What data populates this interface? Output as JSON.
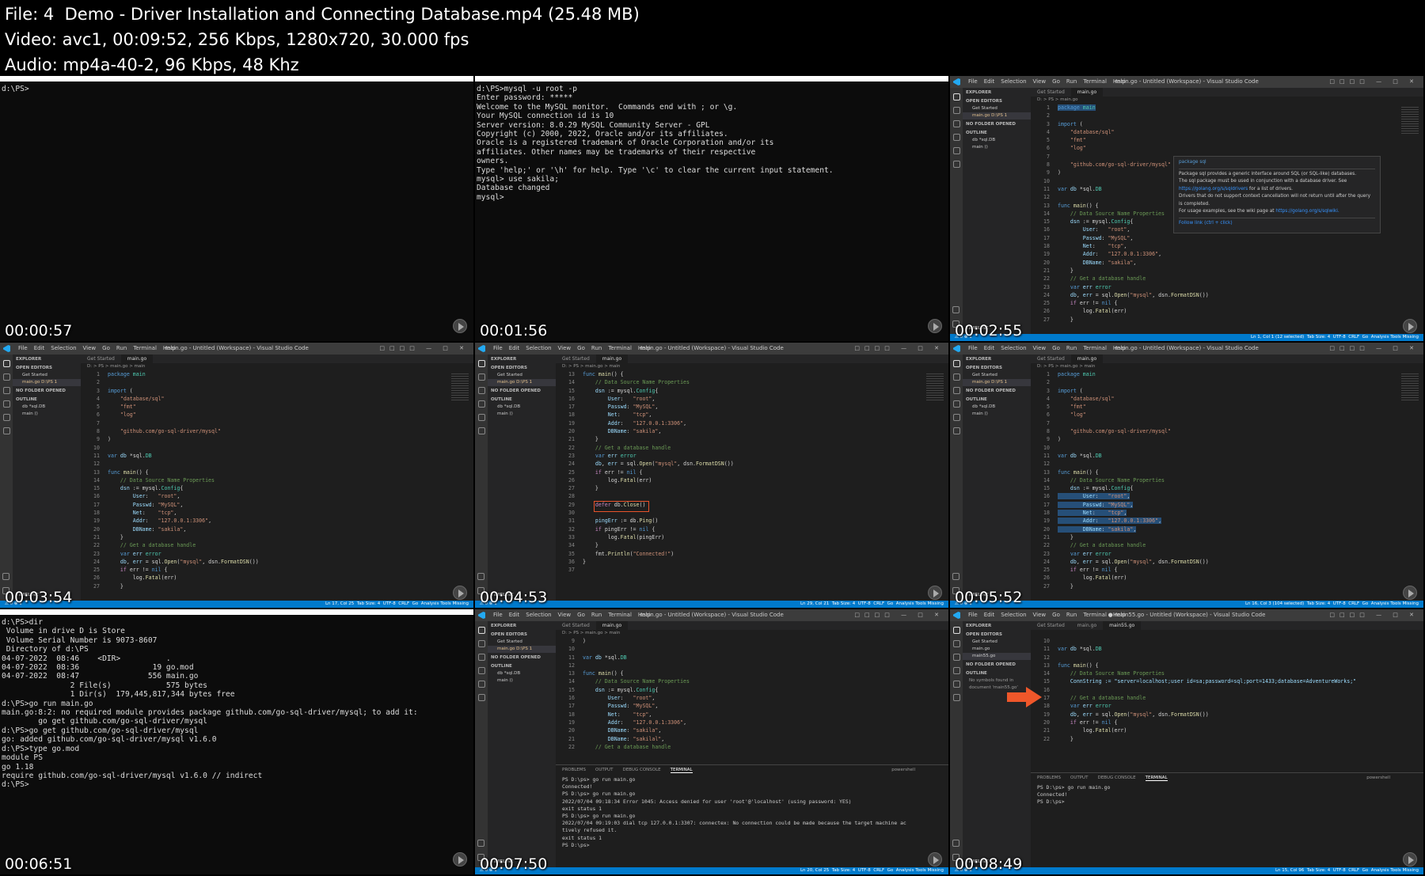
{
  "header": {
    "file": "File: 4  Demo - Driver Installation and Connecting Database.mp4 (25.48 MB)",
    "video": "Video: avc1, 00:09:52, 256 Kbps, 1280x720, 30.000 fps",
    "audio": "Audio: mp4a-40-2, 96 Kbps, 48 Khz"
  },
  "thumbnails": [
    {
      "timestamp": "00:00:57"
    },
    {
      "timestamp": "00:01:56"
    },
    {
      "timestamp": "00:02:55"
    },
    {
      "timestamp": "00:03:54"
    },
    {
      "timestamp": "00:04:53"
    },
    {
      "timestamp": "00:05:52"
    },
    {
      "timestamp": "00:06:51"
    },
    {
      "timestamp": "00:07:50"
    },
    {
      "timestamp": "00:08:49"
    }
  ],
  "terminal1": {
    "lines": [
      "d:\\PS>"
    ]
  },
  "terminal2": {
    "lines": [
      "d:\\PS>mysql -u root -p",
      "Enter password: *****",
      "Welcome to the MySQL monitor.  Commands end with ; or \\g.",
      "Your MySQL connection id is 10",
      "Server version: 8.0.29 MySQL Community Server - GPL",
      "",
      "Copyright (c) 2000, 2022, Oracle and/or its affiliates.",
      "",
      "Oracle is a registered trademark of Oracle Corporation and/or its",
      "affiliates. Other names may be trademarks of their respective",
      "owners.",
      "",
      "Type 'help;' or '\\h' for help. Type '\\c' to clear the current input statement.",
      "",
      "mysql> use sakila;",
      "Database changed",
      "mysql>"
    ]
  },
  "terminal7": {
    "lines": [
      "d:\\PS>dir",
      " Volume in drive D is Store",
      " Volume Serial Number is 9073-8607",
      "",
      " Directory of d:\\PS",
      "",
      "04-07-2022  08:46    <DIR>          .",
      "04-07-2022  08:36                19 go.mod",
      "04-07-2022  08:47               556 main.go",
      "               2 File(s)            575 bytes",
      "               1 Dir(s)  179,445,817,344 bytes free",
      "",
      "d:\\PS>go run main.go",
      "main.go:8:2: no required module provides package github.com/go-sql-driver/mysql; to add it:",
      "        go get github.com/go-sql-driver/mysql",
      "",
      "d:\\PS>go get github.com/go-sql-driver/mysql",
      "go: added github.com/go-sql-driver/mysql v1.6.0",
      "",
      "d:\\PS>type go.mod",
      "module PS",
      "",
      "go 1.18",
      "",
      "require github.com/go-sql-driver/mysql v1.6.0 // indirect",
      "",
      "d:\\PS>"
    ]
  },
  "vscode": {
    "menu": [
      "File",
      "Edit",
      "Selection",
      "View",
      "Go",
      "Run",
      "Terminal",
      "Help"
    ],
    "title": "main.go - Untitled (Workspace) - Visual Studio Code",
    "title_unsaved": "● main55.go - Untitled (Workspace) - Visual Studio Code",
    "explorer_label": "EXPLORER",
    "open_editors": "OPEN EDITORS",
    "no_folder": "NO FOLDER OPENED",
    "outline": "OUTLINE",
    "timeline": "TIMELINE",
    "tab_get_started": "Get Started",
    "tab_main": "main.go",
    "tab_main55": "main55.go",
    "open_file": "main.go D:\\PS 1",
    "outline_db": "db *sql.DB",
    "outline_main": "main ()",
    "crumb": "D: > PS > main.go > main",
    "crumb2": "D: > PS > main.go",
    "no_symbols": "No symbols found in document 'main55.go'",
    "unsaved_badge": "1 UNSAVED",
    "panel_tabs": [
      "PROBLEMS",
      "OUTPUT",
      "DEBUG CONSOLE",
      "TERMINAL"
    ],
    "panel_shell": "powershell",
    "status_lang": "Go",
    "status_analysis": "Analysis Tools Missing",
    "status_enc": "UTF-8",
    "status_eol": "CRLF",
    "status_tab": "Tab Size: 4",
    "status3": "Ln 1, Col 1 (12 selected)",
    "status4": "Ln 17, Col 25",
    "status5": "Ln 29, Col 21",
    "status6": "Ln 16, Col 3 (104 selected)",
    "status8": "Ln 20, Col 25",
    "status9": "Ln 15, Col 96",
    "hover": {
      "title": "package sql",
      "p1": "Package sql provides a generic interface around SQL (or SQL-like) databases.",
      "p2": "The sql package must be used in conjunction with a database driver. See",
      "p2link": "https://golang.org/s/sqldrivers",
      "p2end": "for a list of drivers.",
      "p3": "Drivers that do not support context cancellation will not return until after the query is completed.",
      "p4": "For usage examples, see the wiki page at",
      "p4link": "https://golang.org/s/sqlwiki.",
      "follow": "Follow link (ctrl + click)"
    },
    "term8": [
      "PS D:\\ps> go run main.go",
      "Connected!",
      "PS D:\\ps> go run main.go",
      "2022/07/04 09:18:34 Error 1045: Access denied for user 'root'@'localhost' (using password: YES)",
      "exit status 1",
      "PS D:\\ps> go run main.go",
      "2022/07/04 09:19:03 dial tcp 127.0.0.1:3307: connectex: No connection could be made because the target machine ac",
      "tively refused it.",
      "exit status 1",
      "PS D:\\ps>"
    ],
    "term9": [
      "PS D:\\ps> go run main.go",
      "Connected!",
      "PS D:\\ps>"
    ],
    "conn_string": "ConnString := \"server=localhost;user id=sa;password=sql;port=1433;database=AdventureWorks;\""
  }
}
